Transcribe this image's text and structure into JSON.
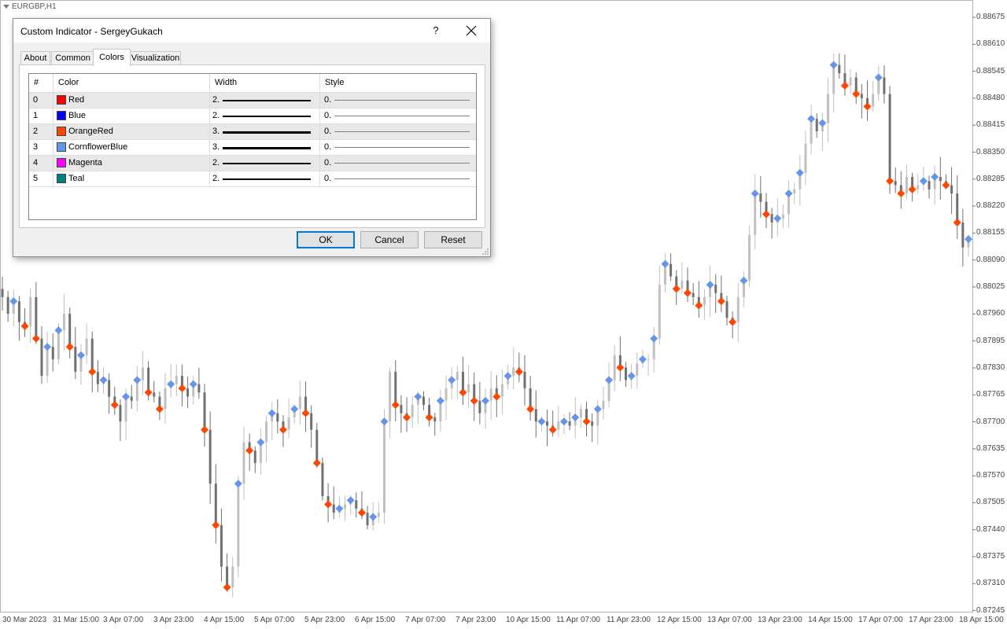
{
  "chart": {
    "symbol": "EURGBP,H1",
    "price_scale": [
      "0.88675",
      "0.88610",
      "0.88545",
      "0.88480",
      "0.88415",
      "0.88350",
      "0.88285",
      "0.88220",
      "0.88155",
      "0.88090",
      "0.88025",
      "0.87960",
      "0.87895",
      "0.87830",
      "0.87765",
      "0.87700",
      "0.87635",
      "0.87570",
      "0.87505",
      "0.87440",
      "0.87375",
      "0.87310",
      "0.87245"
    ],
    "time_scale": [
      "30 Mar 2023",
      "31 Mar 15:00",
      "3 Apr 07:00",
      "3 Apr 23:00",
      "4 Apr 15:00",
      "5 Apr 07:00",
      "5 Apr 23:00",
      "6 Apr 15:00",
      "7 Apr 07:00",
      "7 Apr 23:00",
      "10 Apr 15:00",
      "11 Apr 07:00",
      "11 Apr 23:00",
      "12 Apr 15:00",
      "13 Apr 07:00",
      "13 Apr 23:00",
      "14 Apr 15:00",
      "17 Apr 07:00",
      "17 Apr 23:00",
      "18 Apr 15:00"
    ],
    "colors": {
      "bull_candle": "#c0c0c0",
      "bear_candle": "#707070",
      "marker_up": "#6495ed",
      "marker_down": "#ff4500"
    }
  },
  "chart_data": {
    "type": "candlestick",
    "symbol": "EURGBP",
    "timeframe": "H1",
    "ylim": [
      0.87245,
      0.88675
    ],
    "close_path": [
      0.88,
      0.8796,
      0.8799,
      0.8794,
      0.8793,
      0.88,
      0.879,
      0.8781,
      0.8788,
      0.8785,
      0.8792,
      0.8796,
      0.8788,
      0.8782,
      0.8786,
      0.879,
      0.8782,
      0.8779,
      0.878,
      0.8776,
      0.8774,
      0.877,
      0.8776,
      0.8775,
      0.878,
      0.8783,
      0.8777,
      0.8776,
      0.8773,
      0.8778,
      0.8779,
      0.8781,
      0.8778,
      0.8776,
      0.8779,
      0.8777,
      0.8768,
      0.8755,
      0.8745,
      0.8735,
      0.873,
      0.8735,
      0.8755,
      0.8765,
      0.8763,
      0.876,
      0.8765,
      0.877,
      0.8772,
      0.877,
      0.8768,
      0.8771,
      0.8773,
      0.8776,
      0.8772,
      0.8768,
      0.876,
      0.8752,
      0.875,
      0.8748,
      0.8749,
      0.875,
      0.8751,
      0.8749,
      0.8748,
      0.8745,
      0.8747,
      0.8748,
      0.877,
      0.8782,
      0.8774,
      0.8772,
      0.8771,
      0.8774,
      0.8776,
      0.8774,
      0.8771,
      0.877,
      0.8775,
      0.8778,
      0.878,
      0.8782,
      0.8777,
      0.8779,
      0.8775,
      0.8772,
      0.8775,
      0.8778,
      0.8776,
      0.8779,
      0.8781,
      0.8783,
      0.8782,
      0.8778,
      0.8773,
      0.877,
      0.877,
      0.8769,
      0.8768,
      0.877,
      0.877,
      0.8769,
      0.8771,
      0.8773,
      0.877,
      0.8769,
      0.8773,
      0.8775,
      0.878,
      0.8786,
      0.8783,
      0.878,
      0.8781,
      0.8784,
      0.8785,
      0.8785,
      0.879,
      0.8803,
      0.8808,
      0.8805,
      0.8802,
      0.8804,
      0.8801,
      0.88,
      0.8798,
      0.88,
      0.8803,
      0.8801,
      0.8799,
      0.8795,
      0.8794,
      0.88,
      0.8804,
      0.8815,
      0.8825,
      0.8823,
      0.882,
      0.8818,
      0.8819,
      0.882,
      0.8825,
      0.8826,
      0.883,
      0.8837,
      0.8843,
      0.884,
      0.8842,
      0.8849,
      0.8856,
      0.8854,
      0.8851,
      0.8853,
      0.8849,
      0.8848,
      0.8846,
      0.8849,
      0.8853,
      0.8849,
      0.8828,
      0.8827,
      0.8825,
      0.8829,
      0.8826,
      0.8827,
      0.8828,
      0.8826,
      0.8829,
      0.8828,
      0.8827,
      0.8825,
      0.8818,
      0.8812,
      0.8814
    ]
  },
  "dialog": {
    "title": "Custom Indicator - SergeyGukach",
    "help_label": "?",
    "tabs": [
      "About",
      "Common",
      "Colors",
      "Visualization"
    ],
    "active_tab": "Colors",
    "columns": {
      "num": "#",
      "color": "Color",
      "width": "Width",
      "style": "Style"
    },
    "rows": [
      {
        "index": "0",
        "color_name": "Red",
        "hex": "#ff0000",
        "width": "2.",
        "style": "0."
      },
      {
        "index": "1",
        "color_name": "Blue",
        "hex": "#0000ff",
        "width": "2.",
        "style": "0."
      },
      {
        "index": "2",
        "color_name": "OrangeRed",
        "hex": "#ff4500",
        "width": "3.",
        "style": "0."
      },
      {
        "index": "3",
        "color_name": "CornflowerBlue",
        "hex": "#6495ed",
        "width": "3.",
        "style": "0."
      },
      {
        "index": "4",
        "color_name": "Magenta",
        "hex": "#ff00ff",
        "width": "2.",
        "style": "0."
      },
      {
        "index": "5",
        "color_name": "Teal",
        "hex": "#008080",
        "width": "2.",
        "style": "0."
      }
    ],
    "buttons": {
      "ok": "OK",
      "cancel": "Cancel",
      "reset": "Reset"
    }
  }
}
